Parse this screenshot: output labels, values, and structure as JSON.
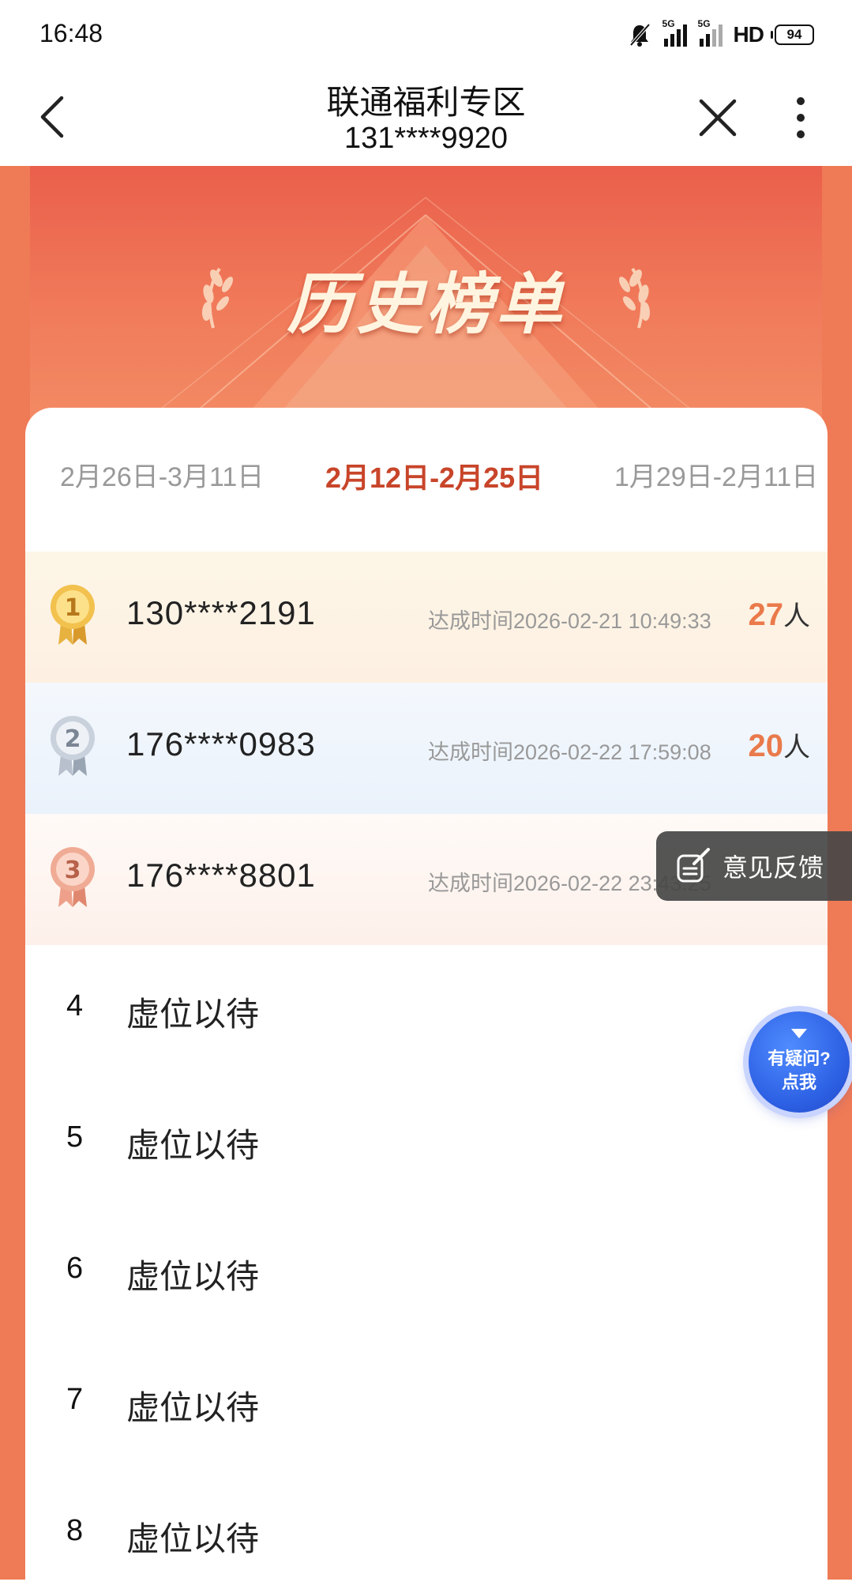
{
  "status_bar": {
    "time": "16:48",
    "network_1": "5G",
    "network_2": "5G",
    "hd": "HD",
    "battery": "94",
    "icons": [
      "mute-bell-icon",
      "signal-5g-icon",
      "signal-5g-icon",
      "hd-icon",
      "battery-icon"
    ]
  },
  "nav": {
    "title": "联通福利专区",
    "subtitle": "131****9920",
    "icons": [
      "back-chevron-icon",
      "close-icon",
      "more-vertical-icon"
    ]
  },
  "banner": {
    "title": "历史榜单"
  },
  "tabs": [
    {
      "label": "2月26日-3月11日",
      "active": false
    },
    {
      "label": "2月12日-2月25日",
      "active": true
    },
    {
      "label": "1月29日-2月11日",
      "active": false
    }
  ],
  "ranking": [
    {
      "rank": "1",
      "phone": "130****2191",
      "time": "达成时间2026-02-21 10:49:33",
      "count": "27",
      "unit": "人"
    },
    {
      "rank": "2",
      "phone": "176****0983",
      "time": "达成时间2026-02-22 17:59:08",
      "count": "20",
      "unit": "人"
    },
    {
      "rank": "3",
      "phone": "176****8801",
      "time": "达成时间2026-02-22 23:43:25",
      "count": "",
      "unit": ""
    },
    {
      "rank": "4",
      "phone": "虚位以待"
    },
    {
      "rank": "5",
      "phone": "虚位以待"
    },
    {
      "rank": "6",
      "phone": "虚位以待"
    },
    {
      "rank": "7",
      "phone": "虚位以待"
    },
    {
      "rank": "8",
      "phone": "虚位以待"
    }
  ],
  "feedback": {
    "label": "意见反馈"
  },
  "help": {
    "line1": "有疑问?",
    "line2": "点我"
  },
  "colors": {
    "accent": "#c8452a",
    "count": "#ea7a4b",
    "page_bg": "#ef7a56",
    "help_button": "#2c5fe3"
  }
}
